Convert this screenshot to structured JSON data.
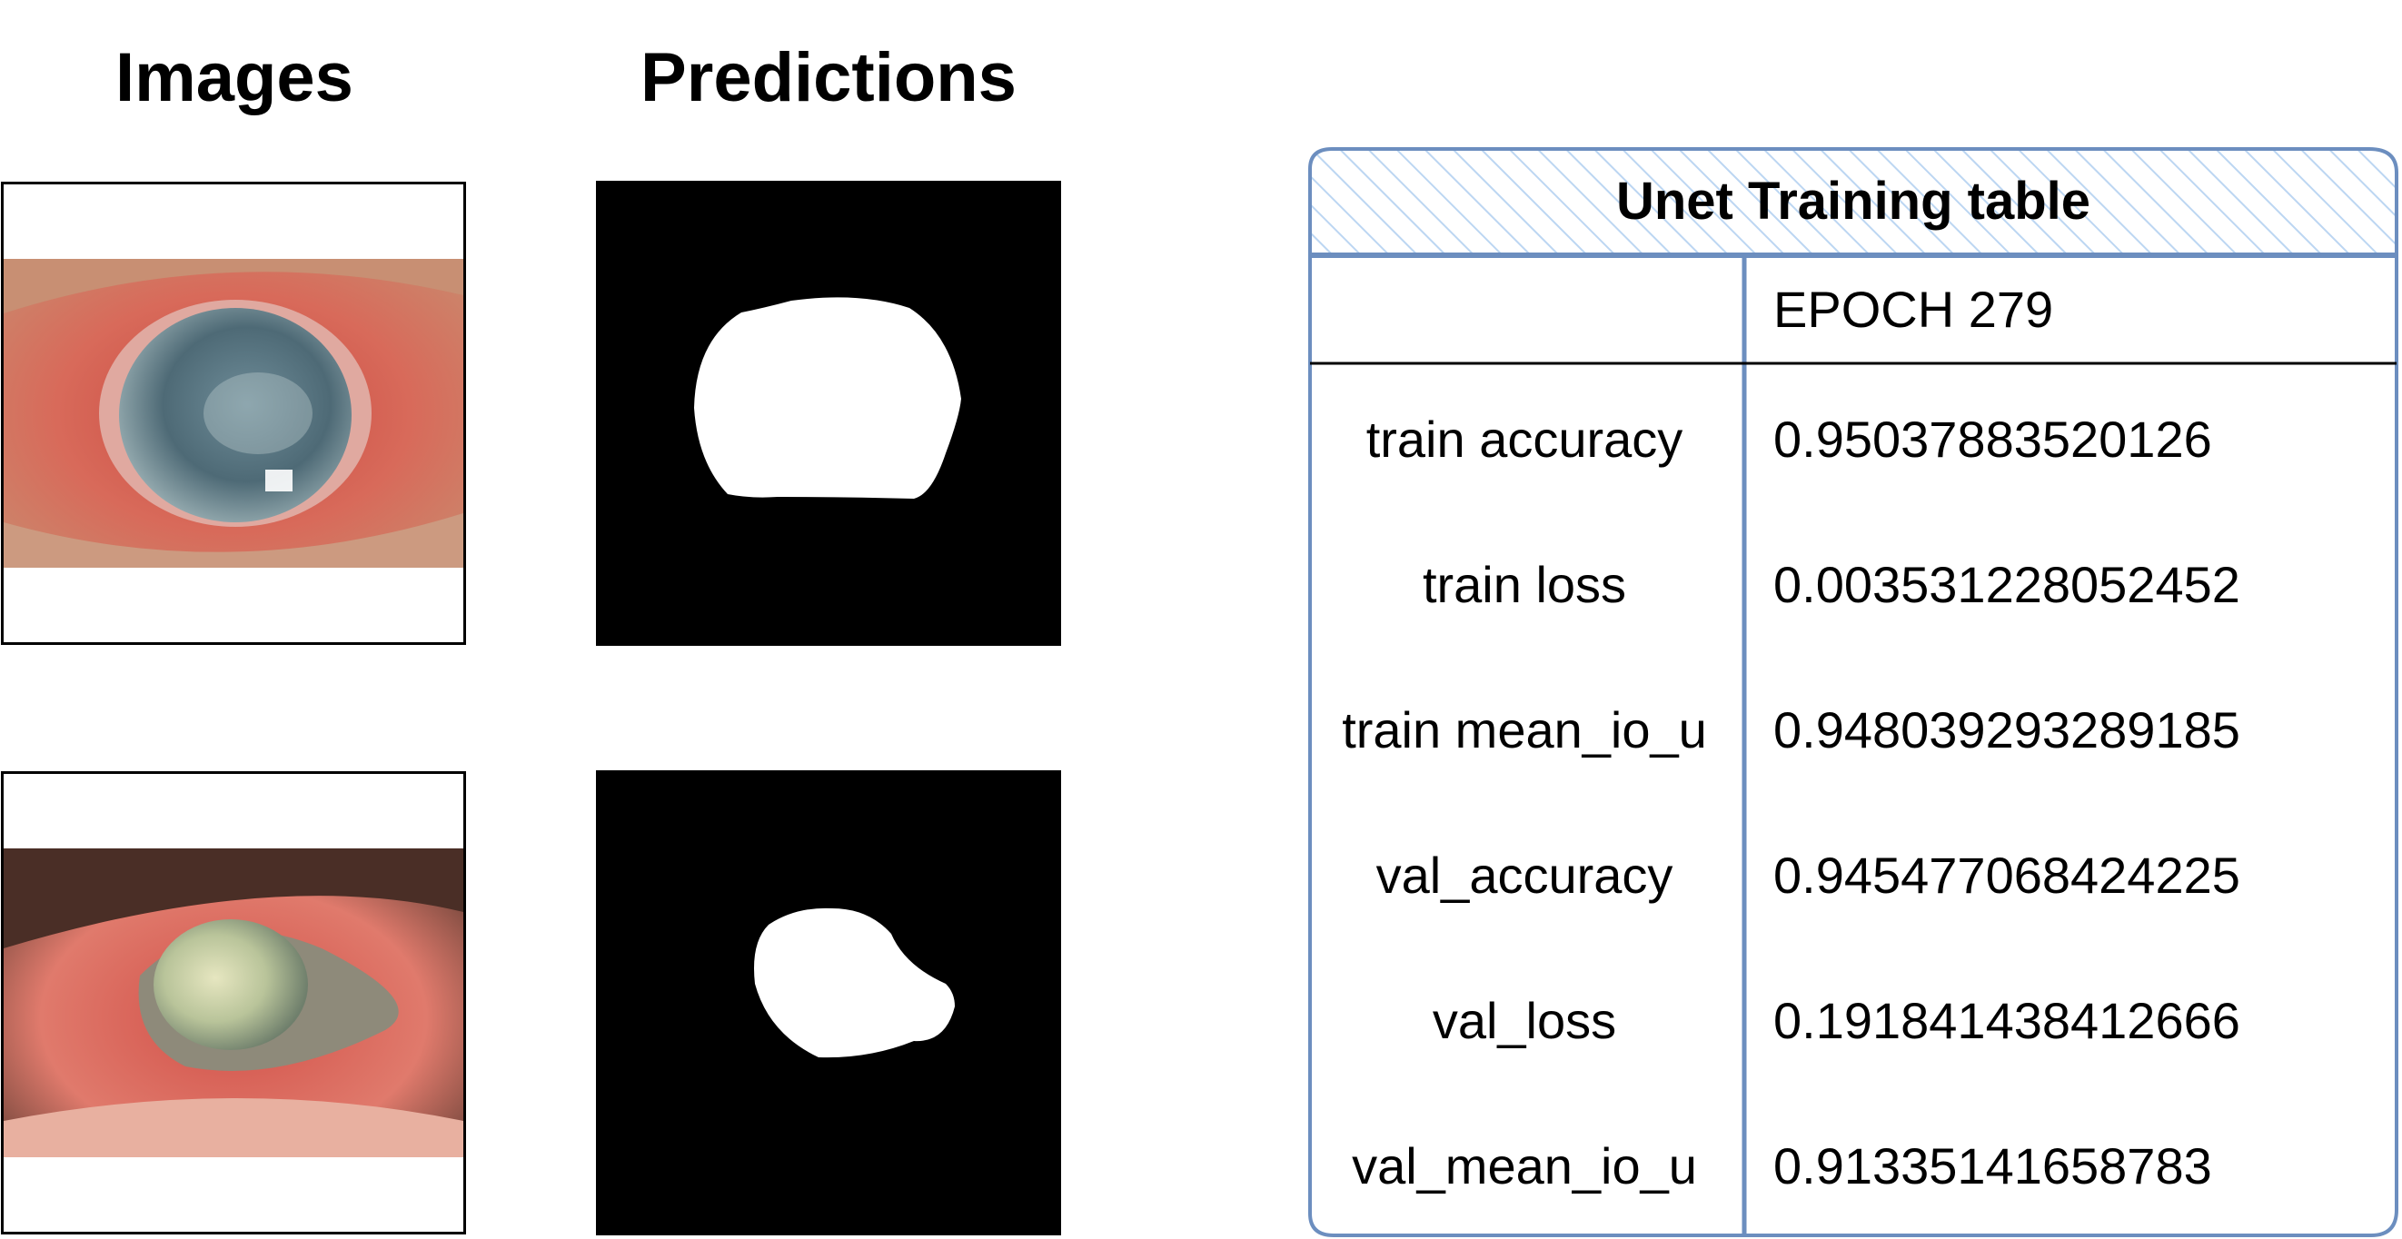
{
  "headings": {
    "images": "Images",
    "predictions": "Predictions"
  },
  "table": {
    "title": "Unet Training table",
    "column_header": "EPOCH 279",
    "rows": [
      {
        "label": "train accuracy",
        "value": "0.95037883520126"
      },
      {
        "label": "train loss",
        "value": "0.003531228052452"
      },
      {
        "label": "train mean_io_u",
        "value": "0.948039293289185"
      },
      {
        "label": "val_accuracy",
        "value": "0.945477068424225"
      },
      {
        "label": "val_loss",
        "value": "0.191841438412666"
      },
      {
        "label": "val_mean_io_u",
        "value": "0.91335141658783"
      }
    ],
    "border_color": "#6c8ebf",
    "header_fill": "#dae8fc"
  }
}
